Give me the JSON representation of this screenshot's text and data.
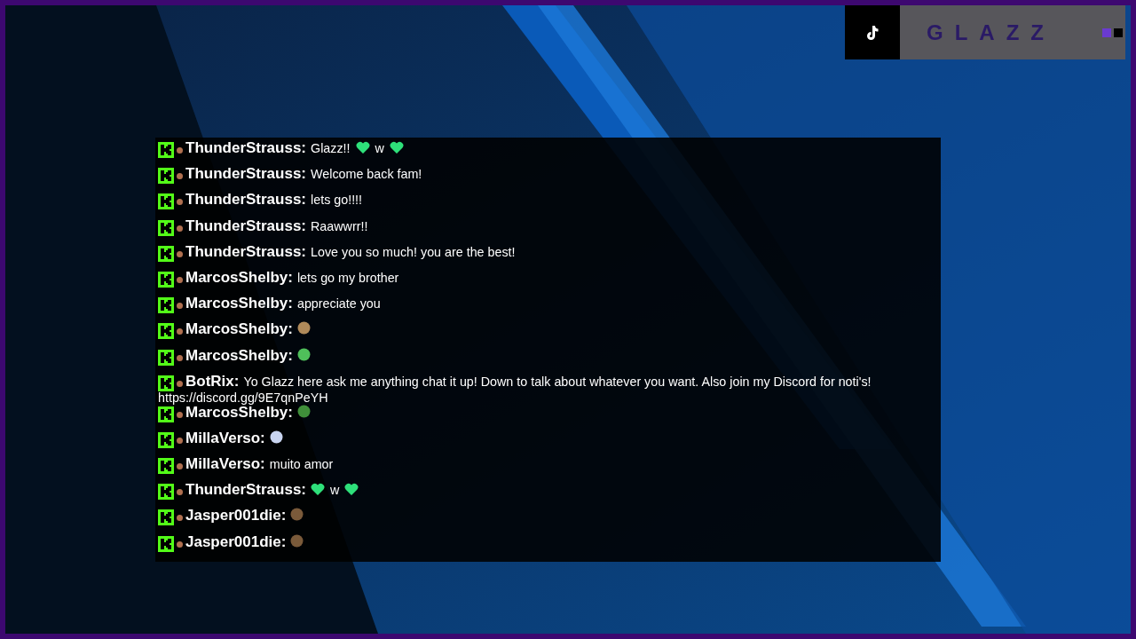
{
  "brand_bar": {
    "name": "GLAZZ"
  },
  "chat": {
    "messages": [
      {
        "user": "ThunderStrauss:",
        "parts": [
          {
            "kind": "text",
            "text": "Glazz!!"
          },
          {
            "kind": "heart"
          },
          {
            "kind": "text",
            "text": "w"
          },
          {
            "kind": "heart"
          }
        ]
      },
      {
        "user": "ThunderStrauss:",
        "parts": [
          {
            "kind": "text",
            "text": "Welcome back fam!"
          }
        ]
      },
      {
        "user": "ThunderStrauss:",
        "parts": [
          {
            "kind": "text",
            "text": "lets go!!!!"
          }
        ]
      },
      {
        "user": "ThunderStrauss:",
        "parts": [
          {
            "kind": "text",
            "text": "Raawwrr!!"
          }
        ]
      },
      {
        "user": "ThunderStrauss:",
        "parts": [
          {
            "kind": "text",
            "text": "Love you so much! you are the best!"
          }
        ]
      },
      {
        "user": "MarcosShelby:",
        "parts": [
          {
            "kind": "text",
            "text": "lets go my brother"
          }
        ]
      },
      {
        "user": "MarcosShelby:",
        "parts": [
          {
            "kind": "text",
            "text": "appreciate you"
          }
        ]
      },
      {
        "user": "MarcosShelby:",
        "parts": [
          {
            "kind": "emote",
            "color": "#b08a5a"
          }
        ]
      },
      {
        "user": "MarcosShelby:",
        "parts": [
          {
            "kind": "emote",
            "color": "#4fbf5a"
          }
        ]
      },
      {
        "user": "BotRix:",
        "parts": [
          {
            "kind": "text",
            "text": "Yo Glazz here ask me anything chat it up! Down to talk about whatever you want. Also join my Discord for noti's!"
          },
          {
            "kind": "link",
            "text": "https://discord.gg/9E7qnPeYH"
          }
        ]
      },
      {
        "user": "MarcosShelby:",
        "parts": [
          {
            "kind": "emote",
            "color": "#3f8f3a"
          }
        ]
      },
      {
        "user": "MillaVerso:",
        "parts": [
          {
            "kind": "emote",
            "color": "#c8d4f0"
          }
        ]
      },
      {
        "user": "MillaVerso:",
        "parts": [
          {
            "kind": "text",
            "text": "muito amor"
          }
        ]
      },
      {
        "user": "ThunderStrauss:",
        "parts": [
          {
            "kind": "heart"
          },
          {
            "kind": "text",
            "text": "w"
          },
          {
            "kind": "heart"
          }
        ]
      },
      {
        "user": "Jasper001die:",
        "parts": [
          {
            "kind": "emote",
            "color": "#7a5a3a"
          }
        ]
      },
      {
        "user": "Jasper001die:",
        "parts": [
          {
            "kind": "emote",
            "color": "#7a5a3a"
          }
        ]
      }
    ]
  }
}
